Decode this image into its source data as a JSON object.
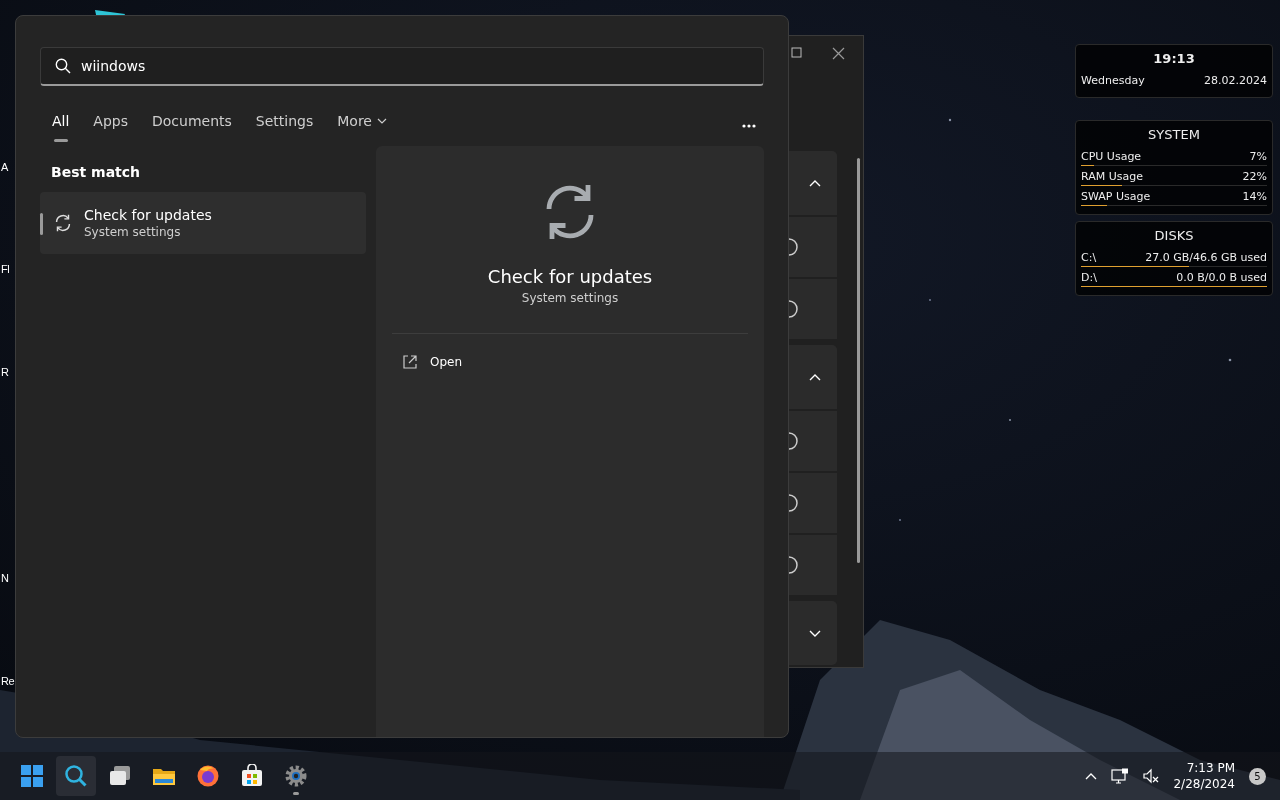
{
  "desktop_labels": [
    "A",
    "Fl",
    "R",
    "N",
    "Re"
  ],
  "search_panel": {
    "query": "wiindows",
    "tabs": [
      {
        "label": "All",
        "selected": true,
        "kind": "tab"
      },
      {
        "label": "Apps",
        "selected": false,
        "kind": "tab"
      },
      {
        "label": "Documents",
        "selected": false,
        "kind": "tab"
      },
      {
        "label": "Settings",
        "selected": false,
        "kind": "tab"
      },
      {
        "label": "More",
        "selected": false,
        "kind": "dropdown"
      }
    ],
    "section_title": "Best match",
    "results": [
      {
        "title": "Check for updates",
        "subtitle": "System settings",
        "selected": true
      }
    ],
    "preview": {
      "title": "Check for updates",
      "subtitle": "System settings",
      "actions": [
        "Open"
      ]
    }
  },
  "background_window": {
    "sections": [
      {
        "expanded": true,
        "rows": [
          {
            "kind": "radio"
          },
          {
            "kind": "radio"
          }
        ]
      },
      {
        "expanded": true,
        "rows": [
          {
            "kind": "radio"
          },
          {
            "kind": "radio"
          },
          {
            "kind": "radio"
          }
        ]
      },
      {
        "expanded": false
      }
    ]
  },
  "widgets": {
    "clock": {
      "time": "19:13",
      "day": "Wednesday",
      "date": "28.02.2024"
    },
    "system": {
      "title": "SYSTEM",
      "rows": [
        {
          "label": "CPU Usage",
          "value": "7%",
          "level": 0.07
        },
        {
          "label": "RAM Usage",
          "value": "22%",
          "level": 0.22
        },
        {
          "label": "SWAP Usage",
          "value": "14%",
          "level": 0.14
        }
      ]
    },
    "disks": {
      "title": "DISKS",
      "rows": [
        {
          "label": "C:\\",
          "value": "27.0 GB/46.6 GB used",
          "level": 0.58
        },
        {
          "label": "D:\\",
          "value": "0.0 B/0.0 B used",
          "level": 1
        }
      ]
    }
  },
  "taskbar": {
    "apps": [
      {
        "kind": "start",
        "selected": false,
        "running": false
      },
      {
        "kind": "search",
        "selected": true,
        "running": false
      },
      {
        "kind": "taskview",
        "selected": false,
        "running": false
      },
      {
        "kind": "folder",
        "selected": false,
        "running": false
      },
      {
        "kind": "browser",
        "selected": false,
        "running": false
      },
      {
        "kind": "store",
        "selected": false,
        "running": false
      },
      {
        "kind": "settings",
        "selected": false,
        "running": true
      }
    ],
    "time": "7:13 PM",
    "date": "2/28/2024",
    "notifications": "5"
  }
}
